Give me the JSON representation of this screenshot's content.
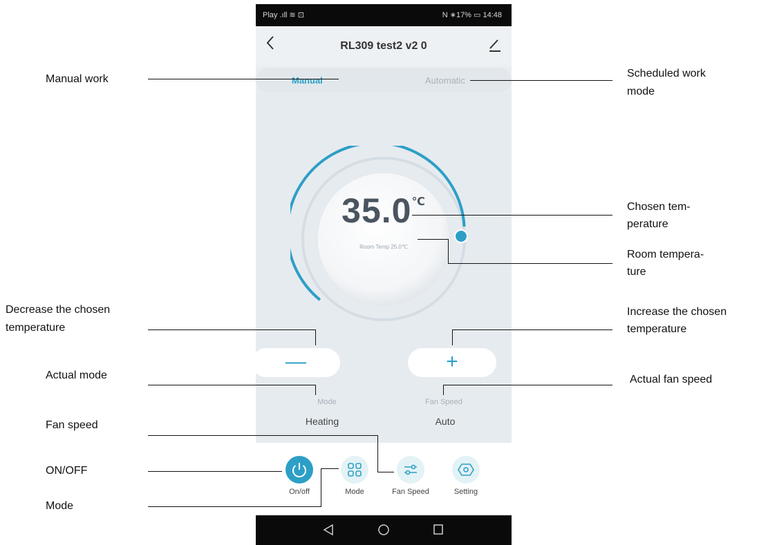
{
  "phone": {
    "status_left": "Play .ıll ≋ ⊡",
    "status_right": "N ∗17% ▭ 14:48",
    "title": "RL309 test2 v2 0",
    "icons": {
      "back": "chevron-left-icon",
      "edit": "pencil-icon"
    },
    "tabs": {
      "manual": "Manual",
      "automatic": "Automatic"
    },
    "temperature": {
      "value": "35.0",
      "unit": "℃"
    },
    "room_temp": "Room Temp 25.0℃",
    "buttons": {
      "decrease": "—",
      "increase": "+"
    },
    "mode_label": "Mode",
    "mode_value": "Heating",
    "fan_label": "Fan Speed",
    "fan_value": "Auto",
    "nav": [
      {
        "label": "On/off",
        "icon": "power-icon"
      },
      {
        "label": "Mode",
        "icon": "grid-icon"
      },
      {
        "label": "Fan Speed",
        "icon": "sliders-icon"
      },
      {
        "label": "Setting",
        "icon": "hexagon-settings-icon"
      }
    ],
    "sys_nav": {
      "back": "◁",
      "home": "○",
      "recent": "□"
    },
    "colors": {
      "accent": "#2d9fc6",
      "panel": "#e6ebf0",
      "status_bar": "#0a0a0a"
    }
  },
  "annotations": {
    "manual_work": "Manual work",
    "scheduled_1": "Scheduled work",
    "scheduled_2": "mode",
    "chosen_temp_1": "Chosen tem-",
    "chosen_temp_2": "perature",
    "room_temp_1": "Room tempera-",
    "room_temp_2": "ture",
    "decrease_1": "Decrease the chosen",
    "decrease_2": "temperature",
    "increase_1": "Increase  the  chosen",
    "increase_2": "temperature",
    "actual_mode": "Actual mode",
    "actual_fan": "Actual fan speed",
    "fan_speed": "Fan speed",
    "on_off": "ON/OFF",
    "mode": "Mode"
  }
}
